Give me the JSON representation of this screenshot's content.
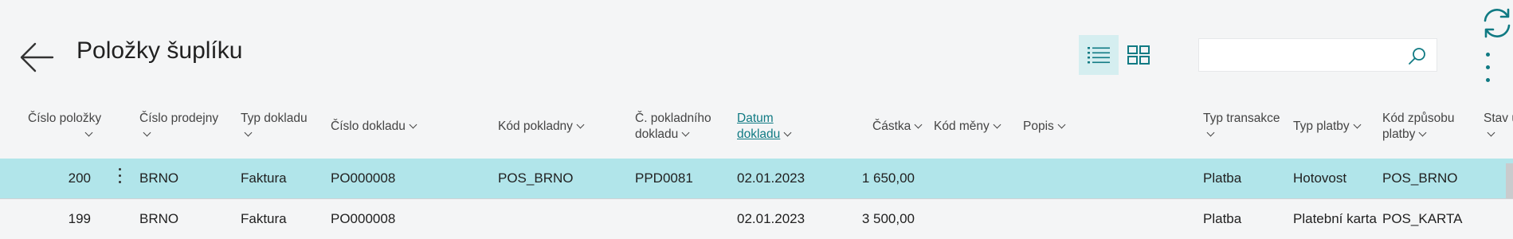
{
  "page": {
    "title": "Položky šuplíku"
  },
  "toolbar": {
    "back_icon": "arrow-left-icon",
    "list_view_icon": "list-icon",
    "tile_view_icon": "tiles-icon",
    "search": {
      "value": "",
      "placeholder": ""
    },
    "search_icon": "search-icon",
    "refresh_icon": "refresh-icon",
    "more_icon": "more-vertical-icon"
  },
  "colors": {
    "accent": "#107a83",
    "selected_row": "#b1e5ea",
    "active_view": "#d5eef0"
  },
  "columns": [
    {
      "line1": "Číslo položky",
      "line2": ""
    },
    {
      "line1": "Číslo prodejny",
      "line2": ""
    },
    {
      "line1": "Typ dokladu",
      "line2": ""
    },
    {
      "line1": "Číslo dokladu",
      "line2": ""
    },
    {
      "line1": "Kód pokladny",
      "line2": ""
    },
    {
      "line1": "Č. pokladního",
      "line2": "dokladu"
    },
    {
      "line1": "Datum",
      "line2": "dokladu"
    },
    {
      "line1": "Částka",
      "line2": ""
    },
    {
      "line1": "Kód měny",
      "line2": ""
    },
    {
      "line1": "Popis",
      "line2": ""
    },
    {
      "line1": "Typ transakce",
      "line2": ""
    },
    {
      "line1": "Typ platby",
      "line2": ""
    },
    {
      "line1": "Kód způsobu",
      "line2": "platby"
    },
    {
      "line1": "Stav u",
      "line2": ""
    }
  ],
  "rows": [
    {
      "cislo_polozky": "200",
      "cislo_prodejny": "BRNO",
      "typ_dokladu": "Faktura",
      "cislo_dokladu": "PO000008",
      "kod_pokladny": "POS_BRNO",
      "c_pokladniho_dokladu": "PPD0081",
      "datum_dokladu": "02.01.2023",
      "castka": "1 650,00",
      "kod_meny": "",
      "popis": "",
      "typ_transakce": "Platba",
      "typ_platby": "Hotovost",
      "kod_zpusobu_platby": "POS_BRNO"
    },
    {
      "cislo_polozky": "199",
      "cislo_prodejny": "BRNO",
      "typ_dokladu": "Faktura",
      "cislo_dokladu": "PO000008",
      "kod_pokladny": "",
      "c_pokladniho_dokladu": "",
      "datum_dokladu": "02.01.2023",
      "castka": "3 500,00",
      "kod_meny": "",
      "popis": "",
      "typ_transakce": "Platba",
      "typ_platby": "Platební karta",
      "kod_zpusobu_platby": "POS_KARTA"
    }
  ]
}
